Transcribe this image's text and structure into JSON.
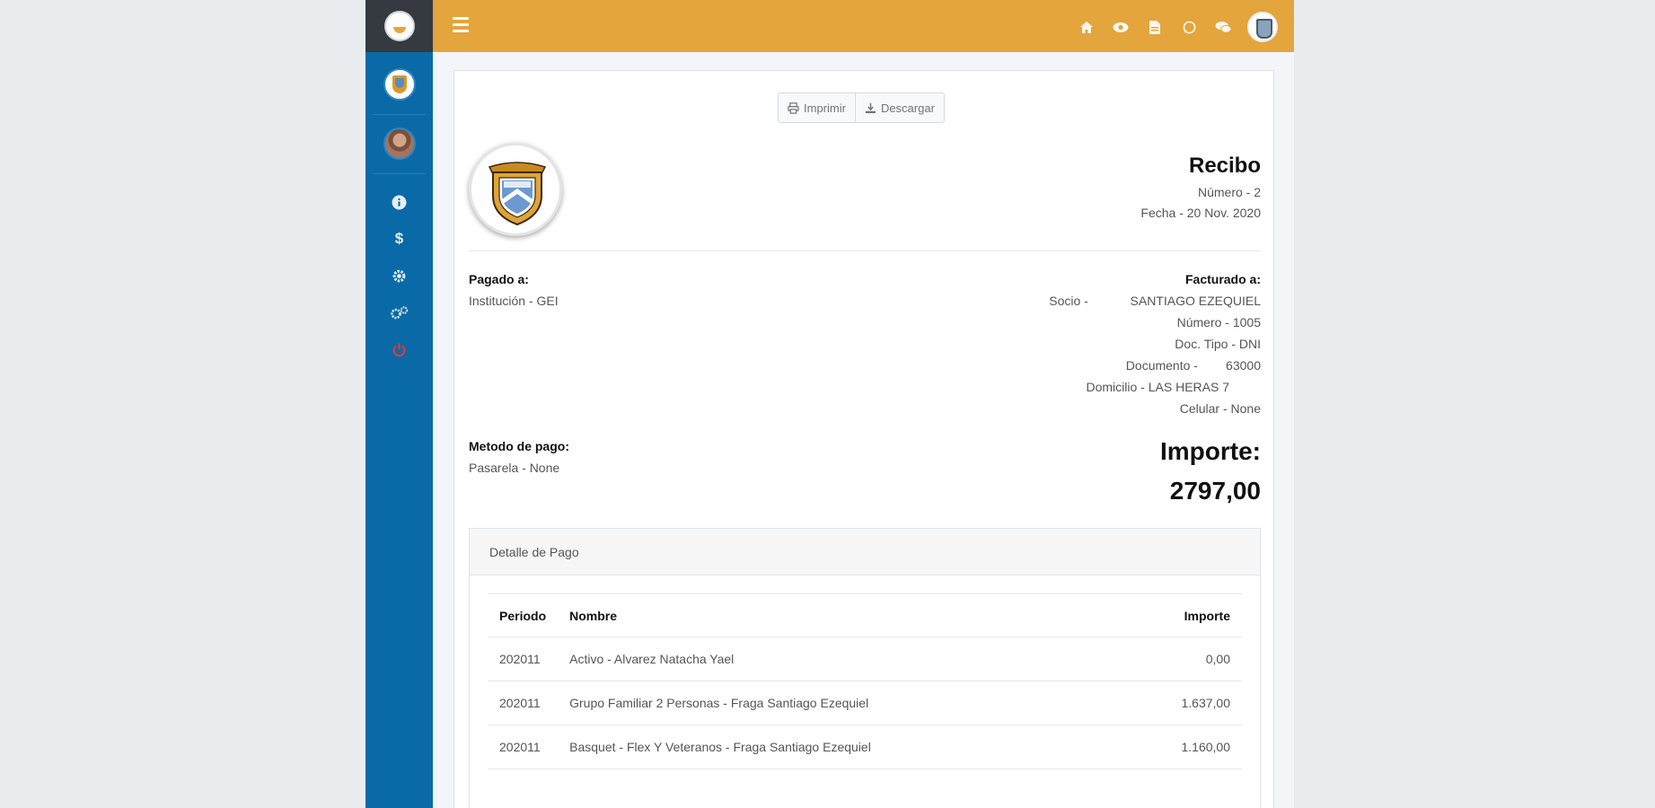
{
  "toolbar": {
    "print_label": "Imprimir",
    "download_label": "Descargar"
  },
  "receipt": {
    "title": "Recibo",
    "number_line": "Número - 2",
    "date_line": "Fecha - 20 Nov. 2020"
  },
  "paid_to": {
    "label": "Pagado a:",
    "institution": "Institución - GEI"
  },
  "billed_to": {
    "label": "Facturado a:",
    "lines": [
      "Socio -            SANTIAGO EZEQUIEL",
      "Número - 1005",
      "Doc. Tipo - DNI",
      "Documento -        63000",
      "Domicilio - LAS HERAS 7         ",
      "Celular - None"
    ]
  },
  "payment_method": {
    "label": "Metodo de pago:",
    "value": "Pasarela - None"
  },
  "amount": {
    "label": "Importe:",
    "value": "2797,00"
  },
  "detail": {
    "title": "Detalle de Pago",
    "columns": [
      "Periodo",
      "Nombre",
      "Importe"
    ],
    "rows": [
      [
        "202011",
        "Activo - Alvarez Natacha Yael",
        "0,00"
      ],
      [
        "202011",
        "Grupo Familiar 2 Personas - Fraga Santiago Ezequiel",
        "1.637,00"
      ],
      [
        "202011",
        "Basquet - Flex Y Veteranos - Fraga Santiago Ezequiel",
        "1.160,00"
      ]
    ]
  },
  "colors": {
    "sidebar": "#0a6aa8",
    "sidebar_brand": "#343a40",
    "topbar": "#e3a53c",
    "danger": "#e03a3a"
  },
  "icons": {
    "topbar": [
      "home-icon",
      "eye-icon",
      "file-icon",
      "whatsapp-icon",
      "comments-icon"
    ],
    "sidebar": [
      "info-icon",
      "dollar-icon",
      "cog-icon",
      "cogs-icon",
      "power-icon"
    ]
  }
}
